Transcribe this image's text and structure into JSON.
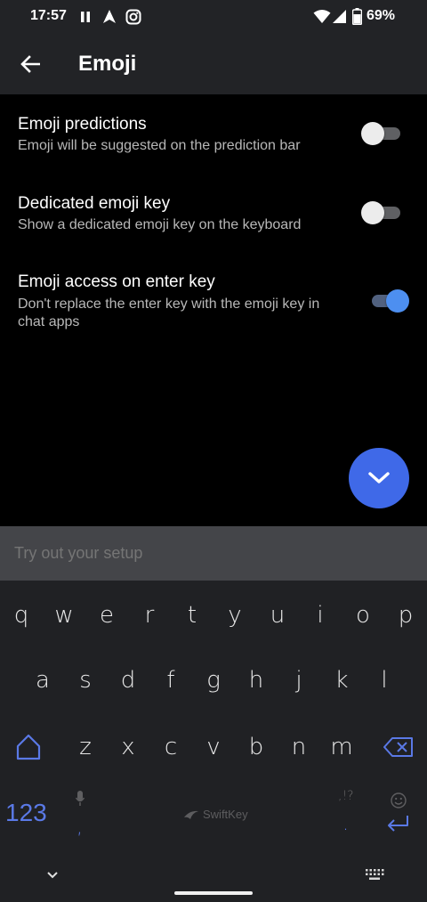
{
  "status_bar": {
    "time": "17:57",
    "battery": "69%",
    "icons": [
      "pause-icon",
      "navigation-icon",
      "instagram-icon",
      "wifi-icon",
      "signal-icon",
      "battery-icon"
    ]
  },
  "app_bar": {
    "title": "Emoji",
    "back_icon": "arrow-left-icon"
  },
  "settings": [
    {
      "title": "Emoji predictions",
      "subtitle": "Emoji will be suggested on the prediction bar",
      "enabled": false
    },
    {
      "title": "Dedicated emoji key",
      "subtitle": "Show a dedicated emoji key on the keyboard",
      "enabled": false
    },
    {
      "title": "Emoji access on enter key",
      "subtitle": "Don't replace the enter key with the emoji key in chat apps",
      "enabled": true
    }
  ],
  "fab": {
    "icon": "chevron-down-icon"
  },
  "try_out": {
    "placeholder": "Try out your setup"
  },
  "keyboard": {
    "row1": [
      "q",
      "w",
      "e",
      "r",
      "t",
      "y",
      "u",
      "i",
      "o",
      "p"
    ],
    "row2": [
      "a",
      "s",
      "d",
      "f",
      "g",
      "h",
      "j",
      "k",
      "l"
    ],
    "row3": [
      "z",
      "x",
      "c",
      "v",
      "b",
      "n",
      "m"
    ],
    "numbers_label": "123",
    "comma": ",",
    "period": ".",
    "punct_hint": ",!?",
    "brand": "SwiftKey",
    "accent": "#5a79e6"
  },
  "colors": {
    "toggle_on": "#4d8ff0",
    "fab": "#3f69e8",
    "background": "#000000",
    "keyboard_bg": "#202124"
  }
}
